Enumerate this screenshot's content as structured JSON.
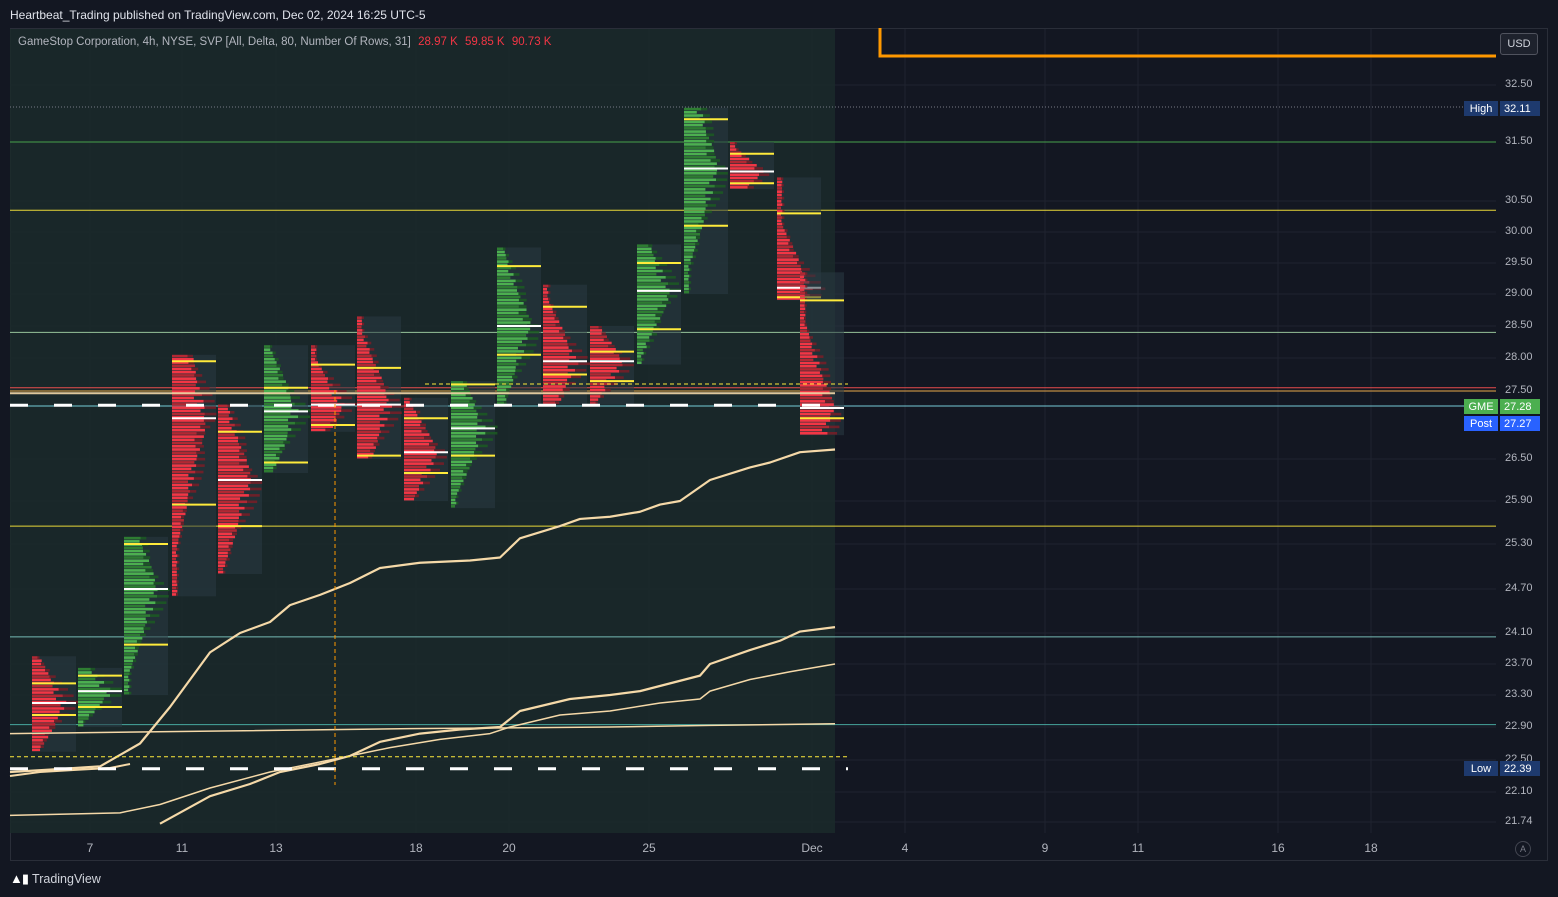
{
  "header": {
    "published": "Heartbeat_Trading published on TradingView.com, Dec 02, 2024 16:25 UTC-5"
  },
  "legend": {
    "text": "GameStop Corporation, 4h, NYSE, SVP [All, Delta, 80, Number Of Rows, 31]",
    "values": [
      "28.97 K",
      "59.85 K",
      "90.73 K"
    ]
  },
  "currency_button": "USD",
  "footer": {
    "brand": "TradingView"
  },
  "auto_button": "A",
  "colors": {
    "background": "#131722",
    "session_shade": "#1b2a2a",
    "bull": "#4caf50",
    "bear": "#f23645",
    "poc": "#ffeb3b",
    "vwap": "#f5d9a8",
    "orange": "#ff9800"
  },
  "chart_data": {
    "type": "volume-profile",
    "symbol": "GME",
    "interval": "4h",
    "exchange": "NYSE",
    "price_axis_labels": [
      "32.50",
      "31.50",
      "30.50",
      "30.00",
      "29.50",
      "29.00",
      "28.50",
      "28.00",
      "27.50",
      "26.50",
      "25.90",
      "25.30",
      "24.70",
      "24.10",
      "23.70",
      "23.30",
      "22.90",
      "22.50",
      "22.10",
      "21.74"
    ],
    "date_axis_labels": [
      "7",
      "11",
      "13",
      "18",
      "20",
      "25",
      "Dec",
      "4",
      "9",
      "11",
      "16",
      "18"
    ],
    "tags": [
      {
        "label": "High",
        "value": "32.11"
      },
      {
        "label": "GME",
        "value": "27.28"
      },
      {
        "label": "Post",
        "value": "27.27"
      },
      {
        "label": "Low",
        "value": "22.39"
      }
    ],
    "horizontal_levels": [
      {
        "price": 31.5,
        "color": "#4caf50"
      },
      {
        "price": 30.35,
        "color": "#ffeb3b"
      },
      {
        "price": 28.4,
        "color": "#a5d6a7"
      },
      {
        "price": 27.55,
        "color": "#ff5252"
      },
      {
        "price": 27.5,
        "color": "#ffb74d"
      },
      {
        "price": 27.28,
        "color": "#80deea"
      },
      {
        "price": 25.55,
        "color": "#ffeb3b"
      },
      {
        "price": 24.05,
        "color": "#80cbc4"
      },
      {
        "price": 22.93,
        "color": "#4db6ac"
      }
    ],
    "profiles": [
      {
        "date": "Nov 6",
        "low": 22.6,
        "high": 23.8,
        "poc": 23.2,
        "vah": 23.45,
        "val": 23.05,
        "dir": "down"
      },
      {
        "date": "Nov 7",
        "low": 22.9,
        "high": 23.65,
        "poc": 23.35,
        "vah": 23.55,
        "val": 23.15,
        "dir": "up"
      },
      {
        "date": "Nov 8",
        "low": 23.3,
        "high": 25.4,
        "poc": 24.7,
        "vah": 25.3,
        "val": 23.95,
        "dir": "up"
      },
      {
        "date": "Nov 11",
        "low": 24.6,
        "high": 28.05,
        "poc": 27.1,
        "vah": 27.95,
        "val": 25.85,
        "dir": "down"
      },
      {
        "date": "Nov 12",
        "low": 24.9,
        "high": 27.3,
        "poc": 26.2,
        "vah": 26.9,
        "val": 25.55,
        "dir": "down"
      },
      {
        "date": "Nov 13",
        "low": 26.3,
        "high": 28.2,
        "poc": 27.2,
        "vah": 27.55,
        "val": 26.45,
        "dir": "up"
      },
      {
        "date": "Nov 14",
        "low": 26.9,
        "high": 28.2,
        "poc": 27.3,
        "vah": 27.9,
        "val": 27.0,
        "dir": "down"
      },
      {
        "date": "Nov 15",
        "low": 26.5,
        "high": 28.65,
        "poc": 27.3,
        "vah": 27.85,
        "val": 26.55,
        "dir": "down"
      },
      {
        "date": "Nov 18",
        "low": 25.9,
        "high": 27.4,
        "poc": 26.6,
        "vah": 27.1,
        "val": 26.3,
        "dir": "down"
      },
      {
        "date": "Nov 19",
        "low": 25.8,
        "high": 27.65,
        "poc": 26.95,
        "vah": 27.6,
        "val": 26.55,
        "dir": "up"
      },
      {
        "date": "Nov 20",
        "low": 27.3,
        "high": 29.75,
        "poc": 28.5,
        "vah": 29.45,
        "val": 28.05,
        "dir": "up"
      },
      {
        "date": "Nov 21",
        "low": 27.3,
        "high": 29.15,
        "poc": 27.95,
        "vah": 28.8,
        "val": 27.75,
        "dir": "down"
      },
      {
        "date": "Nov 22",
        "low": 27.3,
        "high": 28.5,
        "poc": 27.95,
        "vah": 28.1,
        "val": 27.65,
        "dir": "down"
      },
      {
        "date": "Nov 25",
        "low": 27.9,
        "high": 29.8,
        "poc": 29.05,
        "vah": 29.5,
        "val": 28.45,
        "dir": "up"
      },
      {
        "date": "Nov 26",
        "low": 29.0,
        "high": 32.1,
        "poc": 31.05,
        "vah": 31.9,
        "val": 30.1,
        "dir": "up"
      },
      {
        "date": "Nov 27",
        "low": 30.7,
        "high": 31.5,
        "poc": 31.0,
        "vah": 31.3,
        "val": 30.8,
        "dir": "down"
      },
      {
        "date": "Nov 29",
        "low": 28.9,
        "high": 30.9,
        "poc": 29.1,
        "vah": 30.3,
        "val": 28.95,
        "dir": "down"
      },
      {
        "date": "Dec 2",
        "low": 26.85,
        "high": 29.35,
        "poc": 27.25,
        "vah": 28.9,
        "val": 27.1,
        "dir": "down"
      }
    ],
    "averages": [
      {
        "name": "ma-1",
        "color": "#f5d9a8",
        "width": 2.2,
        "points": [
          [
            0,
            22.35
          ],
          [
            40,
            22.38
          ],
          [
            90,
            22.42
          ],
          [
            130,
            22.7
          ],
          [
            160,
            23.15
          ],
          [
            200,
            23.85
          ],
          [
            230,
            24.1
          ],
          [
            260,
            24.25
          ],
          [
            280,
            24.48
          ],
          [
            310,
            24.62
          ],
          [
            340,
            24.78
          ],
          [
            370,
            24.98
          ],
          [
            410,
            25.05
          ],
          [
            460,
            25.08
          ],
          [
            490,
            25.12
          ],
          [
            510,
            25.38
          ],
          [
            550,
            25.55
          ],
          [
            570,
            25.65
          ],
          [
            600,
            25.68
          ],
          [
            630,
            25.75
          ],
          [
            650,
            25.85
          ],
          [
            670,
            25.9
          ],
          [
            700,
            26.2
          ],
          [
            740,
            26.38
          ],
          [
            760,
            26.45
          ],
          [
            790,
            26.6
          ],
          [
            825,
            26.64
          ]
        ]
      },
      {
        "name": "ma-2",
        "color": "#f5d9a8",
        "width": 2.2,
        "points": [
          [
            150,
            21.72
          ],
          [
            200,
            22.05
          ],
          [
            240,
            22.2
          ],
          [
            270,
            22.35
          ],
          [
            310,
            22.45
          ],
          [
            340,
            22.55
          ],
          [
            370,
            22.72
          ],
          [
            410,
            22.82
          ],
          [
            450,
            22.87
          ],
          [
            490,
            22.9
          ],
          [
            510,
            23.1
          ],
          [
            560,
            23.25
          ],
          [
            600,
            23.3
          ],
          [
            630,
            23.35
          ],
          [
            660,
            23.45
          ],
          [
            690,
            23.55
          ],
          [
            700,
            23.7
          ],
          [
            740,
            23.88
          ],
          [
            770,
            24.0
          ],
          [
            790,
            24.12
          ],
          [
            825,
            24.18
          ]
        ]
      },
      {
        "name": "ma-3",
        "color": "#f5d9a8",
        "width": 1.5,
        "points": [
          [
            0,
            21.82
          ],
          [
            110,
            21.85
          ],
          [
            150,
            21.95
          ],
          [
            200,
            22.15
          ],
          [
            260,
            22.35
          ],
          [
            300,
            22.45
          ],
          [
            340,
            22.55
          ],
          [
            380,
            22.65
          ],
          [
            430,
            22.75
          ],
          [
            480,
            22.82
          ],
          [
            500,
            22.9
          ],
          [
            550,
            23.05
          ],
          [
            600,
            23.1
          ],
          [
            650,
            23.2
          ],
          [
            690,
            23.25
          ],
          [
            700,
            23.35
          ],
          [
            740,
            23.5
          ],
          [
            780,
            23.6
          ],
          [
            825,
            23.7
          ]
        ]
      },
      {
        "name": "ma-4",
        "color": "#f5d9a8",
        "width": 1.5,
        "points": [
          [
            0,
            22.82
          ],
          [
            200,
            22.85
          ],
          [
            400,
            22.88
          ],
          [
            600,
            22.9
          ],
          [
            700,
            22.92
          ],
          [
            825,
            22.94
          ]
        ]
      },
      {
        "name": "ma-5",
        "color": "#f5d9a8",
        "width": 2.0,
        "points": [
          [
            0,
            22.3
          ],
          [
            30,
            22.35
          ],
          [
            70,
            22.38
          ],
          [
            100,
            22.4
          ],
          [
            120,
            22.45
          ]
        ]
      }
    ],
    "developing_poc": {
      "price": 27.32,
      "color": "#f5d9a8"
    },
    "session_range": {
      "start": "Nov 5",
      "end": "Dec 2"
    }
  }
}
